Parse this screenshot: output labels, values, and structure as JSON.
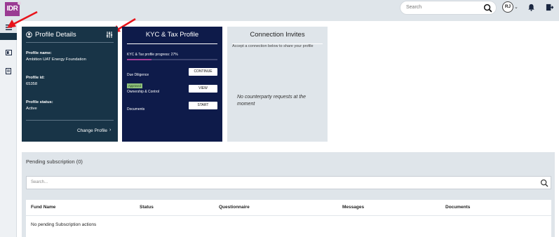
{
  "header": {
    "logo_text": "IDR",
    "search_placeholder": "Search",
    "avatar_initials": "RJ"
  },
  "profile": {
    "title": "Profile Details",
    "name_label": "Profile name:",
    "name_value": "Ambition UAT Energy Foundation",
    "id_label": "Profile id:",
    "id_value": "65358",
    "status_label": "Profile status:",
    "status_value": "Active",
    "change_label": "Change Profile"
  },
  "kyc": {
    "title": "KYC & Tax Profile",
    "progress_label": "KYC & Tax profile progress: 27%",
    "progress_fraction": 0.27,
    "rows": [
      {
        "label": "Due Diligence",
        "button": "CONTINUE"
      },
      {
        "label": "Ownership & Control",
        "button": "VIEW",
        "badge": "Approved"
      },
      {
        "label": "Documents",
        "button": "START"
      }
    ]
  },
  "connections": {
    "title": "Connection Invites",
    "description": "Accept a connection below to share your profile",
    "empty_text": "No counterparty requests at the moment"
  },
  "pending": {
    "title": "Pending subscription (0)",
    "search_placeholder": "Search...",
    "columns": [
      "Fund Name",
      "Status",
      "Questionnaire",
      "Messages",
      "Documents"
    ],
    "empty_text": "No pending Subscription actions"
  },
  "colors": {
    "profile_card": "#183447",
    "kyc_card": "#0e1b4a",
    "accent": "#a23e97",
    "badge_green": "#8ec07c",
    "annotation_arrow": "#e8141b"
  }
}
